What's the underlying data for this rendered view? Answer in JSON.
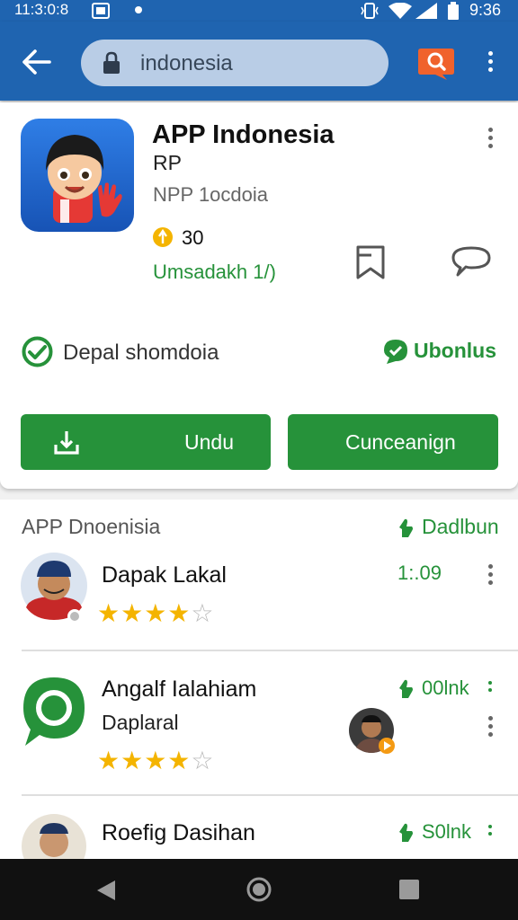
{
  "status_bar": {
    "time_left": "11:3:0:8",
    "time_right": "9:36"
  },
  "search": {
    "query": "indonesia"
  },
  "app": {
    "title": "APP Indonesia",
    "subtitle": "RP",
    "developer": "NPP 1ocdoia",
    "rating": "30",
    "install_status": "Umsadakh 1/)",
    "feature_left": "Depal shomdoia",
    "feature_right": "Ubonlus",
    "download_label": "Undu",
    "second_button_label": "Cunceanign"
  },
  "reviews": {
    "header": "APP Dnoenisia",
    "header_action": "Dadlbun",
    "items": [
      {
        "name": "Dapak Lakal",
        "subtitle": "",
        "meta": "1:.09",
        "stars": 4
      },
      {
        "name": "Angalf Ialahiam",
        "subtitle": "Daplaral",
        "meta": "00lnk",
        "stars": 4
      },
      {
        "name": "Roefig Dasihan",
        "subtitle": "",
        "meta": "S0lnk",
        "stars": 0
      }
    ]
  },
  "colors": {
    "primary": "#1f64b0",
    "accent": "#26923a",
    "star": "#f4b400",
    "search_badge": "#f0622c"
  }
}
